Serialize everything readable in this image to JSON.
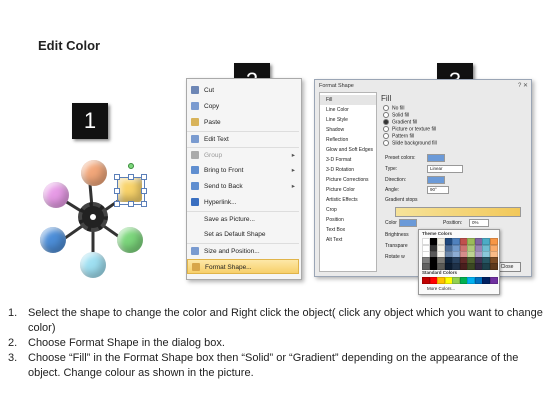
{
  "title": "Edit Color",
  "steps": {
    "one": "1",
    "two": "2",
    "three": "3"
  },
  "orb_colors": [
    "#e79be6",
    "#f2a77a",
    "#4d8ed8",
    "#9fe0f2",
    "#7cd77c",
    "#f8d36a"
  ],
  "context_menu": {
    "items": [
      {
        "label": "Cut",
        "icon": "scissors-icon",
        "disabled": false,
        "submenu": false
      },
      {
        "label": "Copy",
        "icon": "copy-icon",
        "disabled": false,
        "submenu": false
      },
      {
        "label": "Paste",
        "icon": "paste-icon",
        "disabled": false,
        "submenu": false
      },
      {
        "label": "Edit Text",
        "icon": "edit-text-icon",
        "disabled": false,
        "submenu": false
      },
      {
        "label": "Group",
        "icon": "group-icon",
        "disabled": true,
        "submenu": true
      },
      {
        "label": "Bring to Front",
        "icon": "bring-front-icon",
        "disabled": false,
        "submenu": true
      },
      {
        "label": "Send to Back",
        "icon": "send-back-icon",
        "disabled": false,
        "submenu": true
      },
      {
        "label": "Hyperlink...",
        "icon": "hyperlink-icon",
        "disabled": false,
        "submenu": false
      },
      {
        "label": "Save as Picture...",
        "icon": "",
        "disabled": false,
        "submenu": false
      },
      {
        "label": "Set as Default Shape",
        "icon": "",
        "disabled": false,
        "submenu": false
      },
      {
        "label": "Size and Position...",
        "icon": "size-icon",
        "disabled": false,
        "submenu": false
      },
      {
        "label": "Format Shape...",
        "icon": "format-shape-icon",
        "disabled": false,
        "submenu": false
      }
    ]
  },
  "dialog": {
    "title": "Format Shape",
    "close": "?  ✕",
    "categories": [
      "Fill",
      "Line Color",
      "Line Style",
      "Shadow",
      "Reflection",
      "Glow and Soft Edges",
      "3-D Format",
      "3-D Rotation",
      "Picture Corrections",
      "Picture Color",
      "Artistic Effects",
      "Crop",
      "Position",
      "Text Box",
      "Alt Text"
    ],
    "fill_heading": "Fill",
    "fill_options": [
      "No fill",
      "Solid fill",
      "Gradient fill",
      "Picture or texture fill",
      "Pattern fill",
      "Slide background fill"
    ],
    "fields": {
      "preset_label": "Preset colors:",
      "type_label": "Type:",
      "type_value": "Linear",
      "direction_label": "Direction:",
      "angle_label": "Angle:",
      "angle_value": "90°",
      "stops_label": "Gradient stops",
      "color_label": "Color",
      "position_label": "Position:",
      "position_value": "0%",
      "brightness_label": "Brightness",
      "transparency_label": "Transpare",
      "rotate_label": "Rotate w"
    },
    "close_button": "Close"
  },
  "color_popup": {
    "theme_heading": "Theme Colors",
    "standard_heading": "Standard Colors",
    "more_colors": "More Colors...",
    "theme_row": [
      "#ffffff",
      "#000000",
      "#eeece1",
      "#1f497d",
      "#4f81bd",
      "#c0504d",
      "#9bbb59",
      "#8064a2",
      "#4bacc6",
      "#f79646"
    ],
    "standard_row": [
      "#c00000",
      "#ff0000",
      "#ffc000",
      "#ffff00",
      "#92d050",
      "#00b050",
      "#00b0f0",
      "#0070c0",
      "#002060",
      "#7030a0"
    ]
  },
  "instructions": [
    {
      "num": "1.",
      "text": "Select the shape to change the color and Right click the object( click any object which you want to change color)"
    },
    {
      "num": "2.",
      "text": "Choose Format Shape in the dialog box."
    },
    {
      "num": "3.",
      "text": "Choose “Fill” in the Format Shape box then “Solid” or “Gradient” depending on the appearance of the object. Change colour as shown in the picture."
    }
  ]
}
